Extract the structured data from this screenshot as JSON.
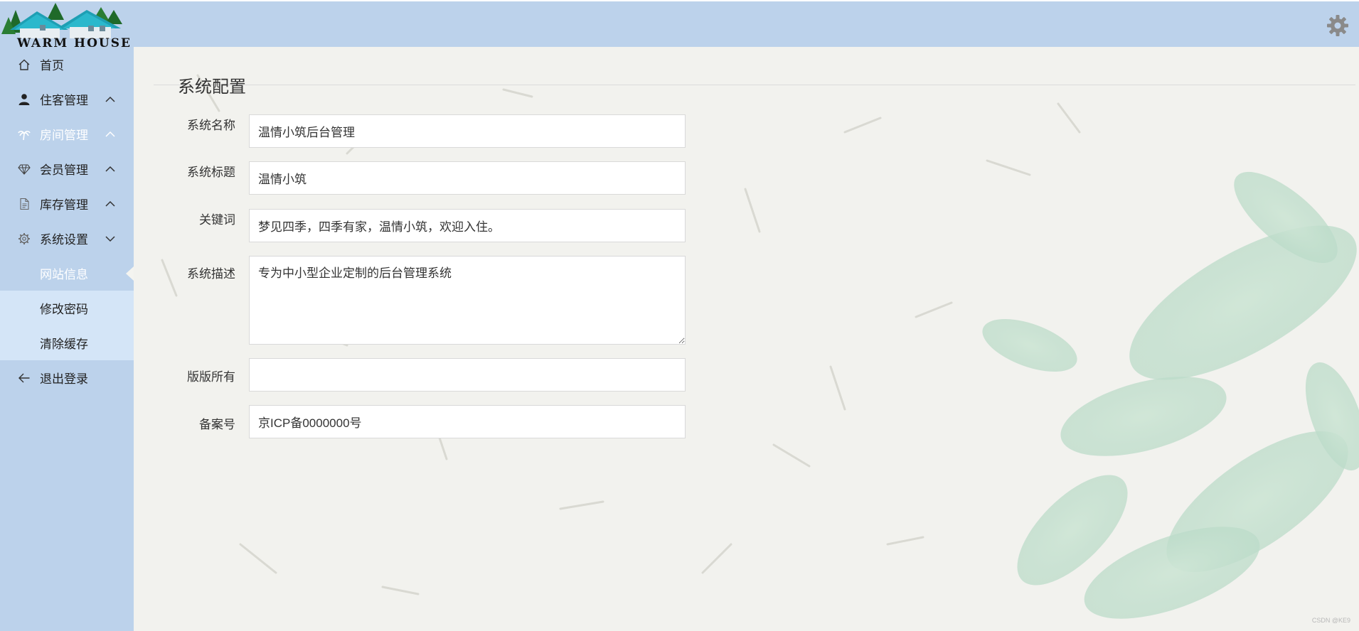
{
  "logo": {
    "text": "WARM HOUSE"
  },
  "sidebar": {
    "items": [
      {
        "label": "首页",
        "icon": "home-icon"
      },
      {
        "label": "住客管理",
        "icon": "user-icon",
        "state": "collapsed"
      },
      {
        "label": "房间管理",
        "icon": "palm-tree-icon",
        "state": "collapsed"
      },
      {
        "label": "会员管理",
        "icon": "diamond-icon",
        "state": "collapsed"
      },
      {
        "label": "库存管理",
        "icon": "document-icon",
        "state": "collapsed"
      },
      {
        "label": "系统设置",
        "icon": "gear-icon",
        "state": "expanded"
      },
      {
        "label": "退出登录",
        "icon": "arrow-left-icon"
      }
    ],
    "sub_items": [
      {
        "label": "网站信息",
        "selected": true
      },
      {
        "label": "修改密码",
        "selected": false
      },
      {
        "label": "清除缓存",
        "selected": false
      }
    ]
  },
  "main": {
    "section_title": "系统配置",
    "form": {
      "system_name": {
        "label": "系统名称",
        "value": "温情小筑后台管理"
      },
      "system_title": {
        "label": "系统标题",
        "value": "温情小筑"
      },
      "keywords": {
        "label": "关键词",
        "value": "梦见四季，四季有家，温情小筑，欢迎入住。"
      },
      "description": {
        "label": "系统描述",
        "value": "专为中小型企业定制的后台管理系统"
      },
      "copyright": {
        "label": "版版所有",
        "value": ""
      },
      "icp": {
        "label": "备案号",
        "value": "京ICP备0000000号"
      }
    }
  },
  "watermark": "CSDN @KE9",
  "colors": {
    "sidebar_bg": "#bcd2eb",
    "submenu_bg": "#d4e5f7",
    "content_bg": "#f2f2ee",
    "active_text": "#ffffff",
    "gear_color": "#8a8a8a"
  }
}
